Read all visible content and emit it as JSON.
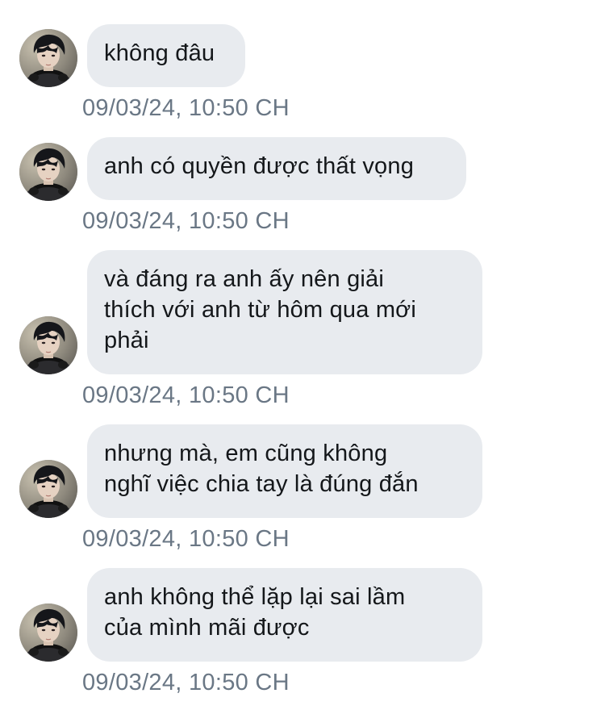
{
  "conversation": {
    "messages": [
      {
        "text": "không đâu",
        "timestamp": "09/03/24, 10:50 CH"
      },
      {
        "text": "anh có quyền được thất vọng",
        "timestamp": "09/03/24, 10:50 CH"
      },
      {
        "text": "và đáng ra anh ấy nên giải\nthích với anh từ hôm qua mới\nphải",
        "timestamp": "09/03/24, 10:50 CH"
      },
      {
        "text": "nhưng mà, em cũng không\nnghĩ việc chia tay là đúng đắn",
        "timestamp": "09/03/24, 10:50 CH"
      },
      {
        "text": "anh không thể lặp lại sai lầm\ncủa mình mãi được",
        "timestamp": "09/03/24, 10:50 CH"
      }
    ]
  },
  "colors": {
    "bubble_background": "#e8ebef",
    "message_text": "#14171a",
    "timestamp_text": "#6a7785"
  },
  "icons": {
    "avatar": "user-avatar-photo"
  }
}
